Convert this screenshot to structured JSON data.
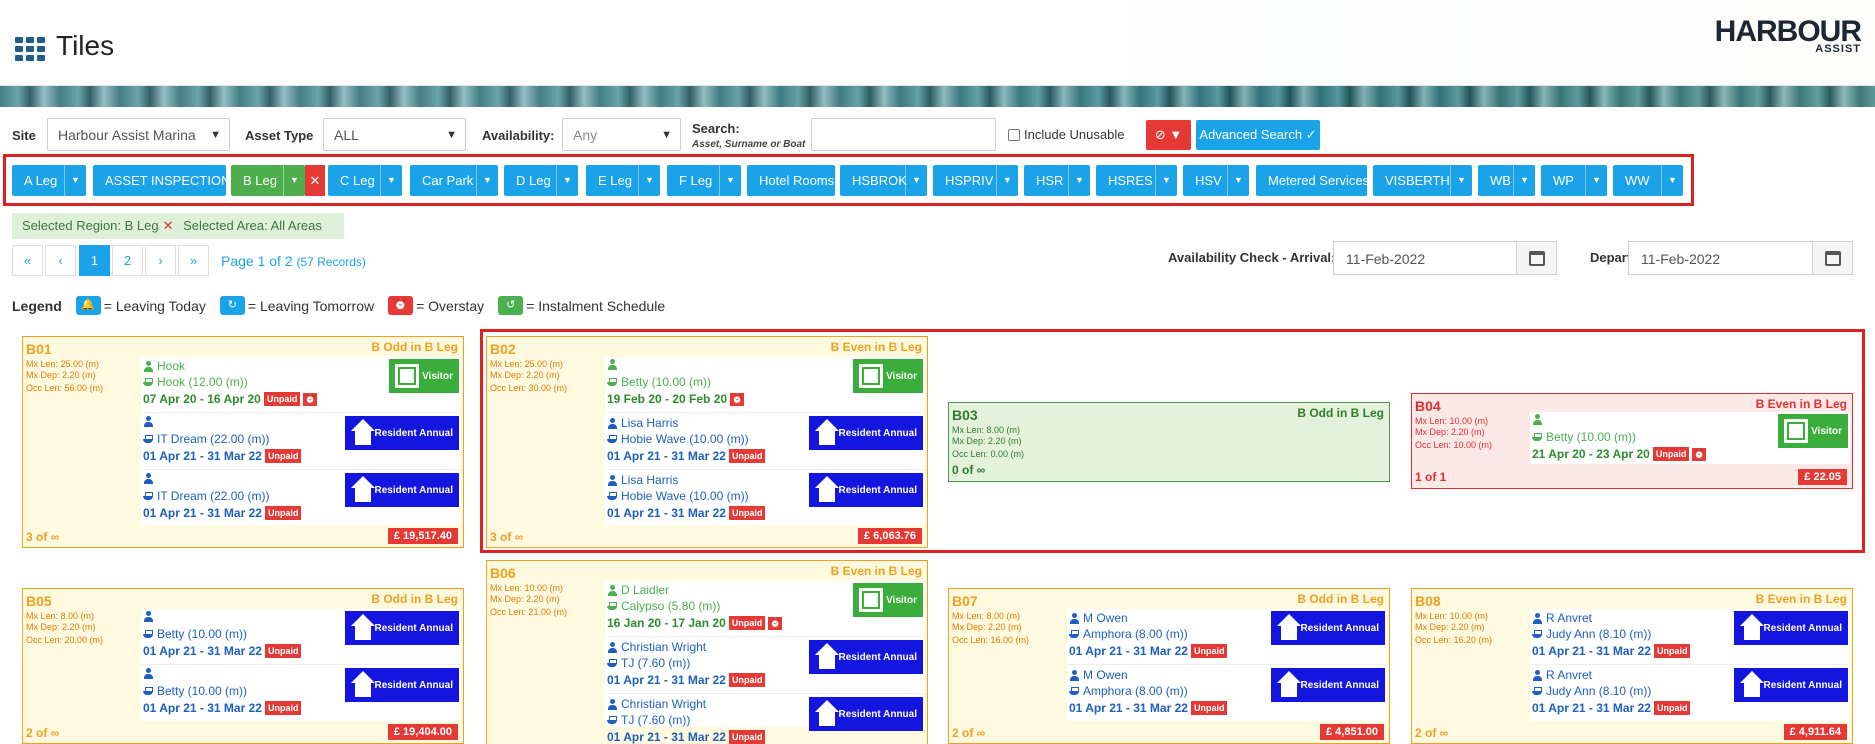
{
  "header": {
    "title": "Tiles",
    "logo_main": "HARBOUR",
    "logo_sub": "ASSIST"
  },
  "filters": {
    "site_label": "Site",
    "site_value": "Harbour Assist Marina",
    "asset_type_label": "Asset Type",
    "asset_type_value": "ALL",
    "availability_label": "Availability:",
    "availability_value": "Any",
    "search_label": "Search:",
    "search_sub": "Asset, Surname or Boat",
    "search_value": "",
    "include_unusable_label": "Include Unusable",
    "advanced_search_label": "Advanced Search ✓"
  },
  "regions": [
    "A Leg",
    "ASSET INSPECTIONS",
    "B Leg",
    "C Leg",
    "Car Park",
    "D Leg",
    "E Leg",
    "F Leg",
    "Hotel Rooms",
    "HSBROK",
    "HSPRIV",
    "HSR",
    "HSRES",
    "HSV",
    "Metered Services",
    "VISBERTH",
    "WB",
    "WP",
    "WW"
  ],
  "selection": {
    "region": "Selected Region: B Leg",
    "area": "Selected Area: All Areas"
  },
  "pagination": {
    "first": "«",
    "prev": "‹",
    "pages": [
      "1",
      "2"
    ],
    "next": "›",
    "last": "»",
    "info": "Page 1 of 2",
    "records": "(57 Records)"
  },
  "availability": {
    "arrival_label": "Availability Check - Arrival:",
    "arrival_date": "11-Feb-2022",
    "depart_label": "Depart:",
    "depart_date": "11-Feb-2022"
  },
  "legend": {
    "title": "Legend",
    "leaving_today": "= Leaving Today",
    "leaving_tomorrow": "= Leaving Tomorrow",
    "overstay": "= Overstay",
    "instalment": "= Instalment Schedule"
  },
  "tiles": [
    {
      "name": "B01",
      "area": "B Odd in B Leg",
      "mx_len": "Mx Len: 25.00 (m)",
      "mx_dep": "Mx Dep: 2.20 (m)",
      "occ": "Occ Len: 56.00 (m)",
      "count": "3 of ∞",
      "total": "£ 19,517.40",
      "bookings": [
        {
          "person": "Hook",
          "boat": "Hook (12.00 (m))",
          "dates": "07 Apr 20 - 16 Apr 20",
          "unpaid": "Unpaid",
          "badge": "Visitor"
        },
        {
          "person": "",
          "boat": "IT Dream (22.00 (m))",
          "dates": "01 Apr 21 - 31 Mar 22",
          "unpaid": "Unpaid",
          "badge": "Resident Annual"
        },
        {
          "person": "",
          "boat": "IT Dream (22.00 (m))",
          "dates": "01 Apr 21 - 31 Mar 22",
          "unpaid": "Unpaid",
          "badge": "Resident Annual"
        }
      ]
    },
    {
      "name": "B02",
      "area": "B Even in B Leg",
      "mx_len": "Mx Len: 25.00 (m)",
      "mx_dep": "Mx Dep: 2.20 (m)",
      "occ": "Occ Len: 30.00 (m)",
      "count": "3 of ∞",
      "total": "£ 6,063.76",
      "bookings": [
        {
          "person": "",
          "boat": "Betty (10.00 (m))",
          "dates": "19 Feb 20 - 20 Feb 20",
          "unpaid": "",
          "badge": "Visitor"
        },
        {
          "person": "Lisa Harris",
          "boat": "Hobie Wave (10.00 (m))",
          "dates": "01 Apr 21 - 31 Mar 22",
          "unpaid": "Unpaid",
          "badge": "Resident Annual"
        },
        {
          "person": "Lisa Harris",
          "boat": "Hobie Wave (10.00 (m))",
          "dates": "01 Apr 21 - 31 Mar 22",
          "unpaid": "Unpaid",
          "badge": "Resident Annual"
        }
      ]
    },
    {
      "name": "B03",
      "area": "B Odd in B Leg",
      "mx_len": "Mx Len: 8.00 (m)",
      "mx_dep": "Mx Dep: 2.20 (m)",
      "occ": "Occ Len: 0.00 (m)",
      "count": "0 of ∞"
    },
    {
      "name": "B04",
      "area": "B Even in B Leg",
      "mx_len": "Mx Len: 10.00 (m)",
      "mx_dep": "Mx Dep: 2.20 (m)",
      "occ": "Occ Len: 10.00 (m)",
      "count": "1 of 1",
      "total": "£ 22.05",
      "bookings": [
        {
          "person": "",
          "boat": "Betty (10.00 (m))",
          "dates": "21 Apr 20 - 23 Apr 20",
          "unpaid": "Unpaid",
          "badge": "Visitor"
        }
      ]
    },
    {
      "name": "B05",
      "area": "B Odd in B Leg",
      "mx_len": "Mx Len: 8.00 (m)",
      "mx_dep": "Mx Dep: 2.20 (m)",
      "occ": "Occ Len: 20.00 (m)",
      "count": "2 of ∞",
      "total": "£ 19,404.00",
      "bookings": [
        {
          "person": "",
          "boat": "Betty (10.00 (m))",
          "dates": "01 Apr 21 - 31 Mar 22",
          "unpaid": "Unpaid",
          "badge": "Resident Annual"
        },
        {
          "person": "",
          "boat": "Betty (10.00 (m))",
          "dates": "01 Apr 21 - 31 Mar 22",
          "unpaid": "Unpaid",
          "badge": "Resident Annual"
        }
      ]
    },
    {
      "name": "B06",
      "area": "B Even in B Leg",
      "mx_len": "Mx Len: 10.00 (m)",
      "mx_dep": "Mx Dep: 2.20 (m)",
      "occ": "Occ Len: 21.00 (m)",
      "bookings": [
        {
          "person": "D Laidler",
          "boat": "Calypso (5.80 (m))",
          "dates": "16 Jan 20 - 17 Jan 20",
          "unpaid": "Unpaid",
          "badge": "Visitor"
        },
        {
          "person": "Christian Wright",
          "boat": "TJ (7.60 (m))",
          "dates": "01 Apr 21 - 31 Mar 22",
          "unpaid": "Unpaid",
          "badge": "Resident Annual"
        },
        {
          "person": "Christian Wright",
          "boat": "TJ (7.60 (m))",
          "dates": "01 Apr 21 - 31 Mar 22",
          "unpaid": "Unpaid",
          "badge": "Resident Annual"
        }
      ]
    },
    {
      "name": "B07",
      "area": "B Odd in B Leg",
      "mx_len": "Mx Len: 8.00 (m)",
      "mx_dep": "Mx Dep: 2.20 (m)",
      "occ": "Occ Len: 16.00 (m)",
      "count": "2 of ∞",
      "total": "£ 4,851.00",
      "bookings": [
        {
          "person": "M Owen",
          "boat": "Amphora (8.00 (m))",
          "dates": "01 Apr 21 - 31 Mar 22",
          "unpaid": "Unpaid",
          "badge": "Resident Annual"
        },
        {
          "person": "M Owen",
          "boat": "Amphora (8.00 (m))",
          "dates": "01 Apr 21 - 31 Mar 22",
          "unpaid": "Unpaid",
          "badge": "Resident Annual"
        }
      ]
    },
    {
      "name": "B08",
      "area": "B Even in B Leg",
      "mx_len": "Mx Len: 10.00 (m)",
      "mx_dep": "Mx Dep: 2.20 (m)",
      "occ": "Occ Len: 16.20 (m)",
      "count": "2 of ∞",
      "total": "£ 4,911.64",
      "bookings": [
        {
          "person": "R Anvret",
          "boat": "Judy Ann (8.10 (m))",
          "dates": "01 Apr 21 - 31 Mar 22",
          "unpaid": "Unpaid",
          "badge": "Resident Annual"
        },
        {
          "person": "R Anvret",
          "boat": "Judy Ann (8.10 (m))",
          "dates": "01 Apr 21 - 31 Mar 22",
          "unpaid": "Unpaid",
          "badge": "Resident Annual"
        }
      ]
    }
  ]
}
